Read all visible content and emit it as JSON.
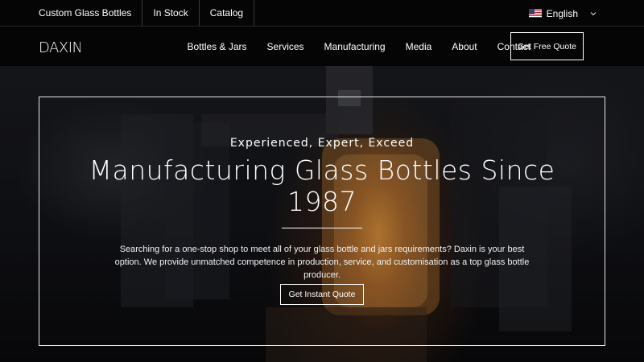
{
  "topbar": {
    "links": [
      "Custom Glass Bottles",
      "In Stock",
      "Catalog"
    ],
    "language": {
      "label": "English",
      "flag": "us-flag-icon"
    }
  },
  "nav": {
    "logo_text": "DAXIN",
    "links": [
      "Bottles & Jars",
      "Services",
      "Manufacturing",
      "Media",
      "About",
      "Contact"
    ],
    "quote_button": "Get Free Quote"
  },
  "hero": {
    "tagline": "Experienced, Expert, Exceed",
    "headline": "Manufacturing Glass Bottles Since 1987",
    "description": "Searching for a one-stop shop to meet all of your glass bottle and jars requirements? Daxin is your best option. We provide unmatched competence in production, service, and customisation as a top glass bottle producer.",
    "cta": "Get Instant Quote",
    "accent_color": "#f39a3a"
  }
}
